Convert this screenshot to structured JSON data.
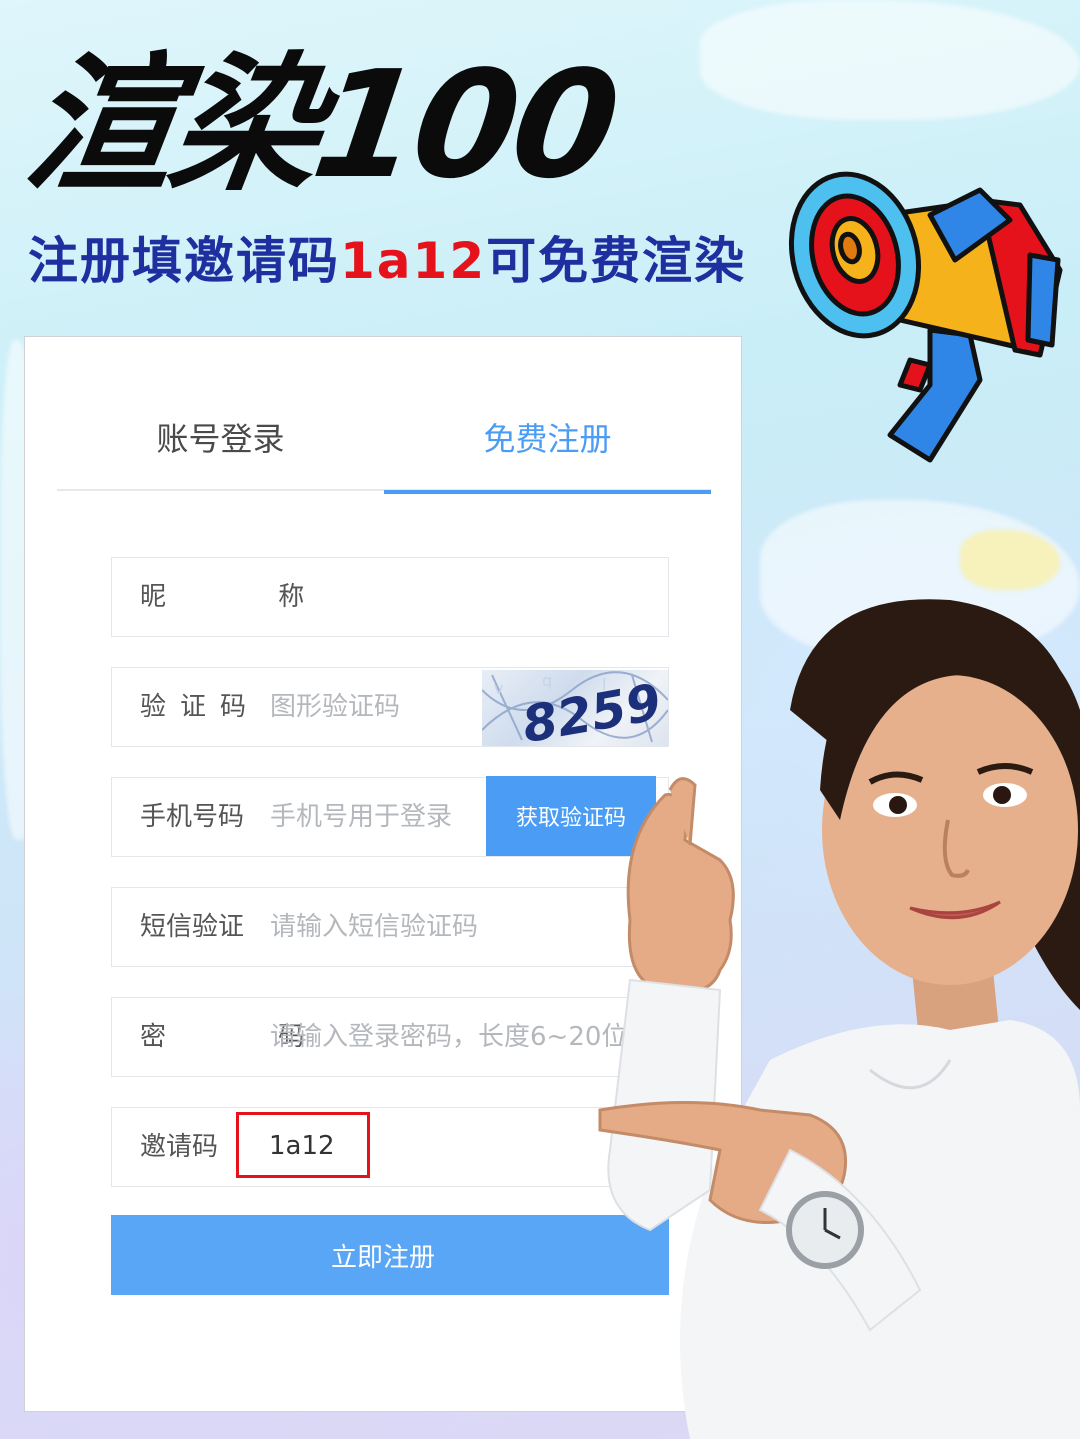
{
  "hero": {
    "title": "渲染100",
    "subtitle_pre": "注册填邀请码",
    "subtitle_code": "1a12",
    "subtitle_post": "可免费渲染"
  },
  "colors": {
    "accent": "#4b9cf4",
    "title": "#0b0b0b",
    "subtitle": "#1e2fa0",
    "highlight": "#e5121b"
  },
  "tabs": {
    "login": "账号登录",
    "register": "免费注册",
    "active": "register"
  },
  "form": {
    "nickname": {
      "label": "昵 称",
      "value": ""
    },
    "captcha": {
      "label": "验证码",
      "placeholder": "图形验证码",
      "image_text": "8259"
    },
    "phone": {
      "label": "手机号码",
      "placeholder": "手机号用于登录",
      "button": "获取验证码"
    },
    "sms": {
      "label": "短信验证",
      "placeholder": "请输入短信验证码"
    },
    "password": {
      "label": "密 码",
      "placeholder": "请输入登录密码，长度6~20位"
    },
    "invite": {
      "label": "邀请码",
      "value": "1a12"
    },
    "submit": "立即注册"
  },
  "decor": {
    "megaphone_icon": "megaphone-icon",
    "person": "woman-pointing-thumbs-up"
  }
}
